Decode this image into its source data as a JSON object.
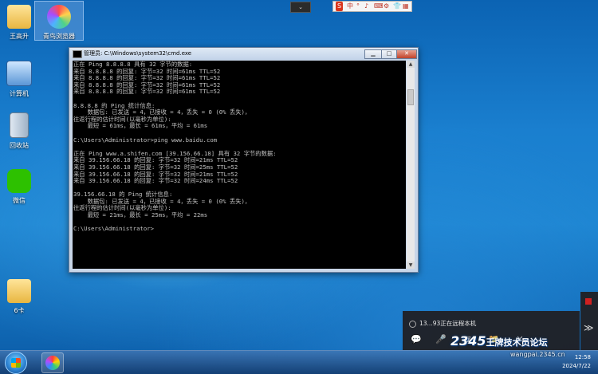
{
  "desktop": {
    "icons": [
      {
        "name": "wang-gaosheng",
        "label": "王高升"
      },
      {
        "name": "qingniao-browser",
        "label": "青鸟浏览器"
      },
      {
        "name": "computer",
        "label": "计算机"
      },
      {
        "name": "recycle-bin",
        "label": "回收站"
      },
      {
        "name": "wechat",
        "label": "微信"
      },
      {
        "name": "folder-6ka",
        "label": "6卡"
      }
    ]
  },
  "cmd_window": {
    "title": "管理员: C:\\Windows\\system32\\cmd.exe",
    "minimize": "▁",
    "maximize": "□",
    "close": "✕",
    "console_text": "正在 Ping 8.8.8.8 具有 32 字节的数据:\n来自 8.8.8.8 的回复: 字节=32 时间=61ms TTL=52\n来自 8.8.8.8 的回复: 字节=32 时间=61ms TTL=52\n来自 8.8.8.8 的回复: 字节=32 时间=61ms TTL=52\n来自 8.8.8.8 的回复: 字节=32 时间=61ms TTL=52\n\n8.8.8.8 的 Ping 统计信息:\n    数据包: 已发送 = 4，已接收 = 4，丢失 = 0 (0% 丢失)，\n往返行程的估计时间(以毫秒为单位):\n    最短 = 61ms，最长 = 61ms，平均 = 61ms\n\nC:\\Users\\Administrator>ping www.baidu.com\n\n正在 Ping www.a.shifen.com [39.156.66.18] 具有 32 字节的数据:\n来自 39.156.66.18 的回复: 字节=32 时间=21ms TTL=52\n来自 39.156.66.18 的回复: 字节=32 时间=25ms TTL=52\n来自 39.156.66.18 的回复: 字节=32 时间=21ms TTL=52\n来自 39.156.66.18 的回复: 字节=32 时间=24ms TTL=52\n\n39.156.66.18 的 Ping 统计信息:\n    数据包: 已发送 = 4，已接收 = 4，丢失 = 0 (0% 丢失)，\n往返行程的估计时间(以毫秒为单位):\n    最短 = 21ms，最长 = 25ms，平均 = 22ms\n\nC:\\Users\\Administrator>"
  },
  "top_controls": {
    "chevron": "⌄",
    "toolstrip": [
      "S",
      "中",
      "°",
      "♪",
      "⌨",
      "⚙",
      "👕",
      "▦"
    ]
  },
  "remote_panel": {
    "status": "13...93正在远程本机",
    "controls": [
      "💬",
      "🎤",
      "▣",
      "📁",
      "✕"
    ]
  },
  "taskbar": {
    "time": "12:58",
    "date": "2024/7/22"
  },
  "watermark": {
    "brand": "2345",
    "text": "王牌技术员论坛",
    "url": "wangpai.2345.cn"
  },
  "colors": {
    "console_bg": "#000000",
    "console_text": "#c0c0c0",
    "taskbar": "#2b5d97",
    "accent": "#0b63b3"
  }
}
